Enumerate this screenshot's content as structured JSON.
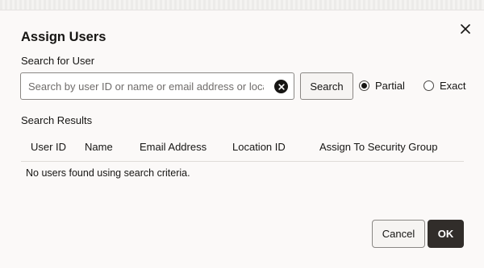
{
  "dialog": {
    "title": "Assign Users",
    "close_icon": "close-icon"
  },
  "search": {
    "label": "Search for User",
    "placeholder": "Search by user ID or name or email address or location",
    "value": "",
    "clear_icon": "clear-circle-icon",
    "button_label": "Search"
  },
  "match_mode": {
    "options": [
      {
        "label": "Partial",
        "selected": true
      },
      {
        "label": "Exact",
        "selected": false
      }
    ]
  },
  "results": {
    "label": "Search Results",
    "columns": [
      "User ID",
      "Name",
      "Email Address",
      "Location ID",
      "Assign To Security Group"
    ],
    "empty_message": "No users found using search criteria."
  },
  "footer": {
    "cancel_label": "Cancel",
    "ok_label": "OK"
  },
  "colors": {
    "dialog_background": "#fbf9f8",
    "primary_button": "#312d2a",
    "text": "#161513",
    "border": "#8a8784"
  }
}
